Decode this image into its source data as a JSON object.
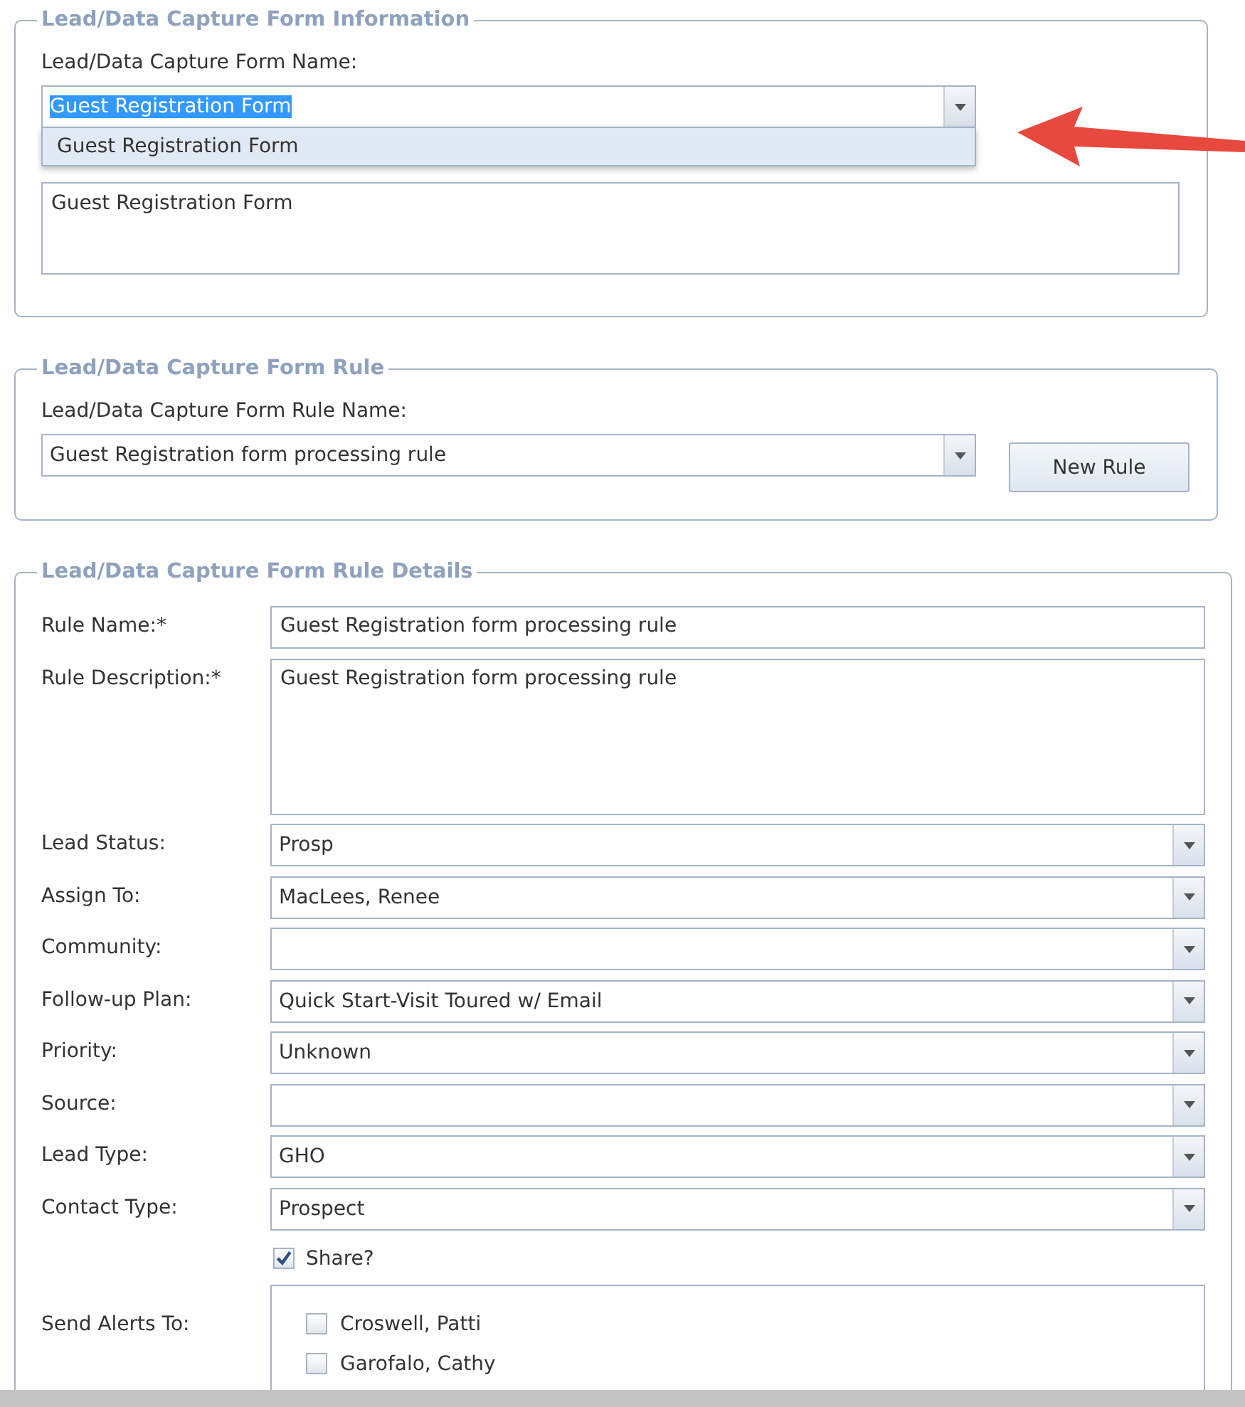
{
  "info_section": {
    "legend": "Lead/Data Capture Form Information",
    "form_name_label": "Lead/Data Capture Form Name:",
    "form_name_combo": {
      "value": "Guest Registration Form",
      "text_selected": true,
      "expanded": true
    },
    "dropdown_options": [
      {
        "label": "Guest Registration Form",
        "selected": true
      }
    ],
    "description": "Guest Registration Form"
  },
  "rule_section": {
    "legend": "Lead/Data Capture Form Rule",
    "rule_name_label": "Lead/Data Capture Form Rule Name:",
    "rule_combo": {
      "value": "Guest Registration form processing rule"
    },
    "new_rule_button": "New Rule"
  },
  "details_section": {
    "legend": "Lead/Data Capture Form Rule Details",
    "fields": [
      {
        "kind": "text",
        "label": "Rule Name:*",
        "value": "Guest Registration form processing rule"
      },
      {
        "kind": "textarea",
        "label": "Rule Description:*",
        "value": "Guest Registration form processing rule"
      },
      {
        "kind": "select",
        "label": "Lead Status:",
        "value": "Prosp"
      },
      {
        "kind": "select",
        "label": "Assign To:",
        "value": "MacLees, Renee"
      },
      {
        "kind": "select",
        "label": "Community:"
      },
      {
        "kind": "select",
        "label": "Follow-up Plan:",
        "value": "Quick Start-Visit Toured w/ Email"
      },
      {
        "kind": "select",
        "label": "Priority:",
        "value": "Unknown"
      },
      {
        "kind": "select",
        "label": "Source:"
      },
      {
        "kind": "select",
        "label": "Lead Type:",
        "value": "GHO"
      },
      {
        "kind": "select",
        "label": "Contact Type:",
        "value": "Prospect"
      }
    ],
    "share": {
      "label": "Share?",
      "checked": true
    },
    "alerts": {
      "label": "Send Alerts To:",
      "recipients": [
        {
          "name": "Croswell, Patti",
          "checked": false
        },
        {
          "name": "Garofalo, Cathy",
          "checked": false
        }
      ]
    }
  }
}
